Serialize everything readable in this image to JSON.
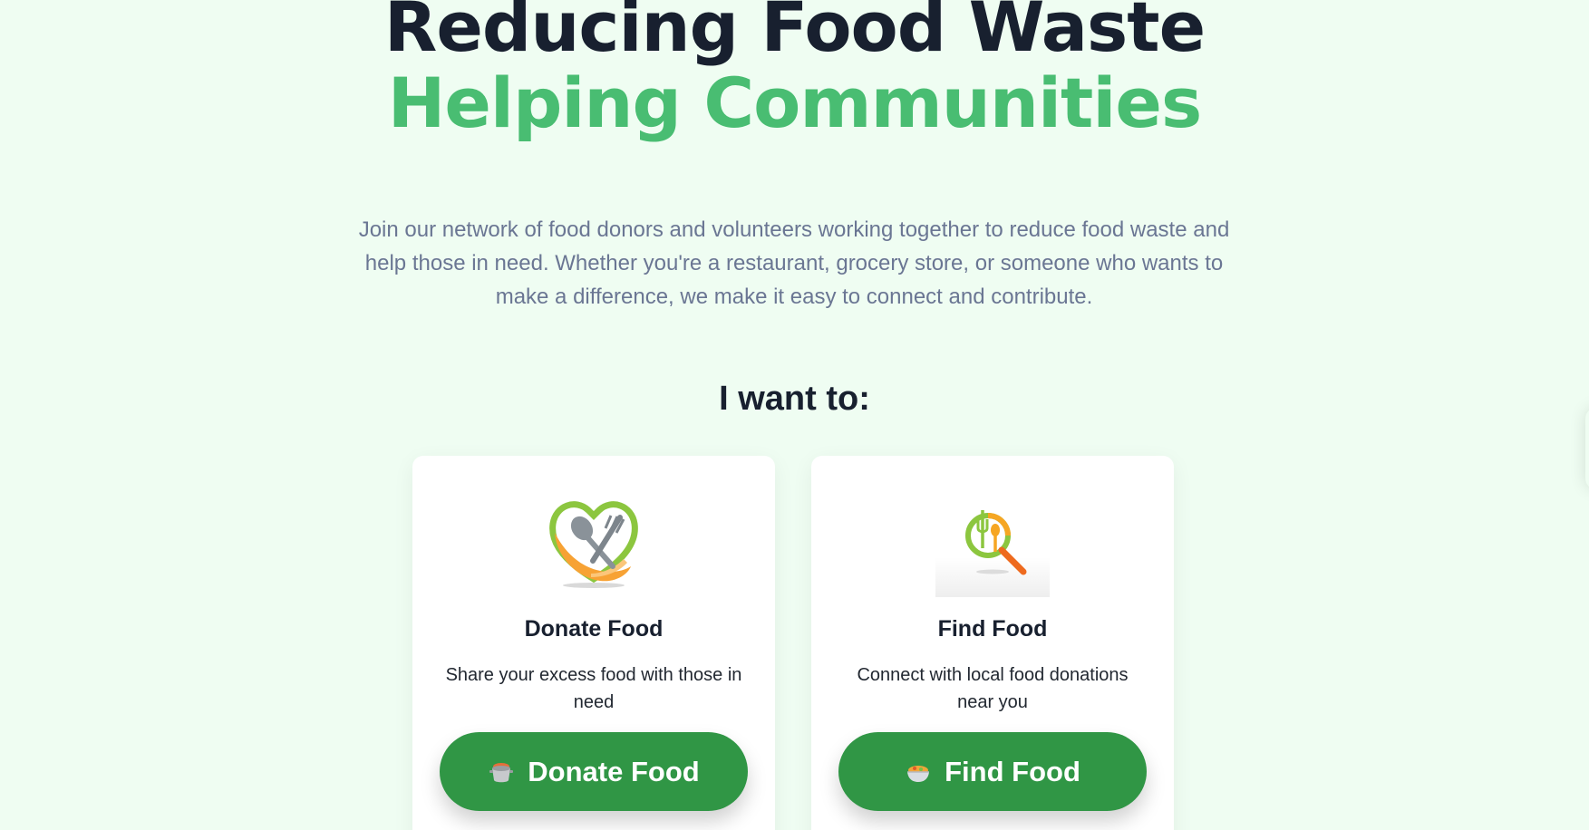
{
  "hero": {
    "title_line1": "Reducing Food Waste",
    "title_line2": "Helping Communities",
    "title_color": "#18202f",
    "accent_color": "#49bd72"
  },
  "intro": {
    "text": "Join our network of food donors and volunteers working together to reduce food waste and help those in need. Whether you're a restaurant, grocery store, or someone who wants to make a difference, we make it easy to connect and contribute."
  },
  "choice": {
    "heading": "I want to:"
  },
  "cards": {
    "donate": {
      "logo": "heart-hand-fork-spoon-logo",
      "title": "Donate Food",
      "description": "Share your excess food with those in need",
      "button_label": "Donate Food",
      "button_icon": "cooking-pot-icon"
    },
    "find": {
      "logo": "magnifier-fork-spoon-logo",
      "title": "Find Food",
      "description": "Connect with local food donations near you",
      "button_label": "Find Food",
      "button_icon": "food-bowl-icon"
    }
  },
  "colors": {
    "background": "#effdf2",
    "button": "#309645",
    "muted_text": "#6a7693"
  }
}
